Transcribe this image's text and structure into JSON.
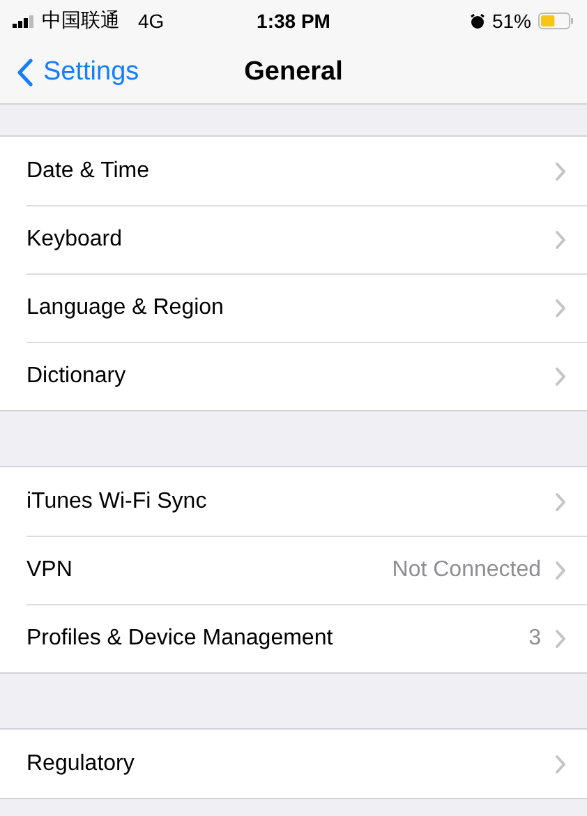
{
  "status_bar": {
    "carrier": "中国联通",
    "network": "4G",
    "time": "1:38 PM",
    "battery": "51%"
  },
  "nav": {
    "back": "Settings",
    "title": "General"
  },
  "groups": [
    {
      "rows": [
        {
          "label": "Date & Time"
        },
        {
          "label": "Keyboard"
        },
        {
          "label": "Language & Region"
        },
        {
          "label": "Dictionary"
        }
      ]
    },
    {
      "rows": [
        {
          "label": "iTunes Wi-Fi Sync"
        },
        {
          "label": "VPN",
          "detail": "Not Connected"
        },
        {
          "label": "Profiles & Device Management",
          "detail": "3"
        }
      ]
    },
    {
      "rows": [
        {
          "label": "Regulatory"
        }
      ]
    }
  ]
}
